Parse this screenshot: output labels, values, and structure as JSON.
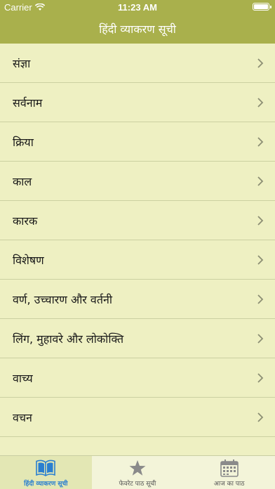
{
  "status_bar": {
    "carrier": "Carrier",
    "time": "11:23 AM"
  },
  "nav": {
    "title": "हिंदी व्याकरण सूची"
  },
  "list": {
    "items": [
      {
        "label": "संज्ञा"
      },
      {
        "label": "सर्वनाम"
      },
      {
        "label": "क्रिया"
      },
      {
        "label": "काल"
      },
      {
        "label": "कारक"
      },
      {
        "label": "विशेषण"
      },
      {
        "label": "वर्ण, उच्चारण और वर्तनी"
      },
      {
        "label": "लिंग, मुहावरे और लोकोक्ति"
      },
      {
        "label": "वाच्य"
      },
      {
        "label": "वचन"
      }
    ]
  },
  "tabs": {
    "items": [
      {
        "label": "हिंदी व्याकरण सूची",
        "icon": "book-icon"
      },
      {
        "label": "फेवरेट पाठ सूची",
        "icon": "star-icon"
      },
      {
        "label": "आज का पाठ",
        "icon": "calendar-icon"
      }
    ]
  },
  "colors": {
    "bar": "#a9b04c",
    "background": "#eef0c2",
    "tab_active": "#2a7fd0"
  }
}
